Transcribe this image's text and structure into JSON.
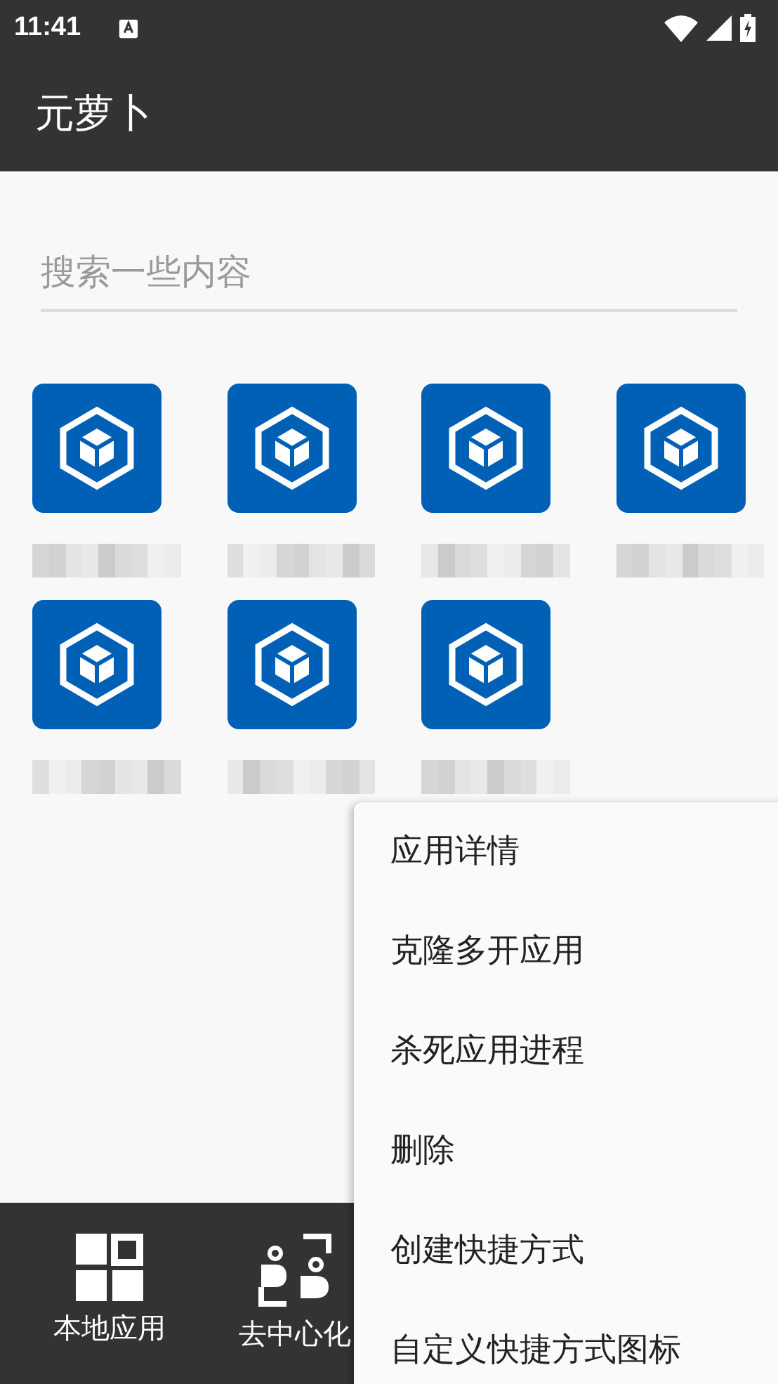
{
  "status_bar": {
    "time": "11:41"
  },
  "app_bar": {
    "title": "元萝卜"
  },
  "search": {
    "placeholder": "搜索一些内容"
  },
  "apps": [
    {
      "kind": "app"
    },
    {
      "kind": "app"
    },
    {
      "kind": "app"
    },
    {
      "kind": "app"
    },
    {
      "kind": "app"
    },
    {
      "kind": "app"
    },
    {
      "kind": "app"
    }
  ],
  "bottom_nav": [
    {
      "label": "本地应用",
      "kind": "grid"
    },
    {
      "label": "去中心化",
      "kind": "people"
    }
  ],
  "context_menu": [
    "应用详情",
    "克隆多开应用",
    "杀死应用进程",
    "删除",
    "创建快捷方式",
    "自定义快捷方式图标"
  ]
}
